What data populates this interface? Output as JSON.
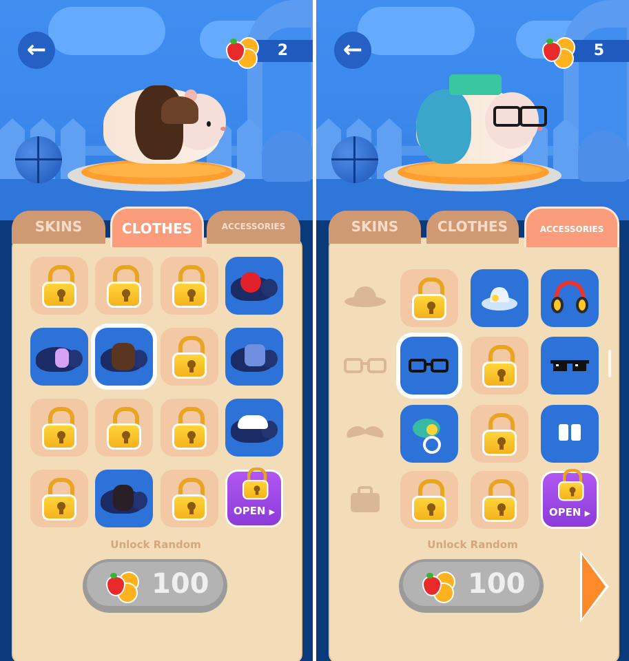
{
  "screens": [
    {
      "coins": "2",
      "tabs": [
        "SKINS",
        "CLOTHES",
        "ACCESSORIES"
      ],
      "active_tab": "CLOTHES",
      "open_label": "OPEN",
      "unlock_label": "Unlock Random",
      "price": "100"
    },
    {
      "coins": "5",
      "tabs": [
        "SKINS",
        "CLOTHES",
        "ACCESSORIES"
      ],
      "active_tab": "ACCESSORIES",
      "open_label": "OPEN",
      "unlock_label": "Unlock Random",
      "price": "100"
    }
  ],
  "icons": {
    "back": "arrow-left-icon",
    "currency": "fruit-icon",
    "lock": "lock-icon",
    "next": "chevron-right-icon"
  },
  "colors": {
    "sky": "#3f8ef0",
    "active_tab": "#fb9c7a",
    "inactive_tab": "#cf9a73",
    "item_slot": "#2c72d8",
    "locked_slot": "#f3c8a5",
    "book": "#f2ddb8",
    "open_button": "#b157f2"
  }
}
